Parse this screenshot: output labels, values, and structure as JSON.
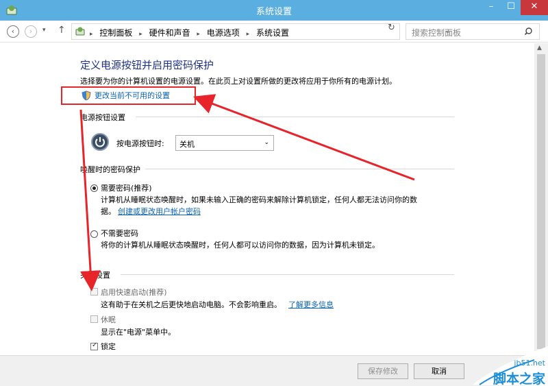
{
  "window": {
    "title": "系统设置",
    "minimize_label": "–",
    "maximize_label": "☐",
    "close_label": "✕"
  },
  "nav": {
    "back": "‹",
    "forward": "›",
    "history": "▾",
    "up": "↑",
    "breadcrumbs": [
      "控制面板",
      "硬件和声音",
      "电源选项",
      "系统设置"
    ],
    "separator": "▸",
    "address_dropdown": "⌄",
    "refresh": "↻",
    "search_placeholder": "搜索控制面板"
  },
  "page": {
    "title": "定义电源按钮并启用密码保护",
    "description": "选择要为你的计算机设置的电源设置。在此页上对设置所做的更改将应用于你所有的电源计划。",
    "change_link": "更改当前不可用的设置"
  },
  "power_button": {
    "section_title": "电源按钮设置",
    "label": "按电源按钮时:",
    "selected_value": "关机",
    "chevron": "⌄"
  },
  "wake_password": {
    "section_title": "唤醒时的密码保护",
    "require": {
      "label": "需要密码(推荐)",
      "selected": true,
      "desc_line1": "计算机从睡眠状态唤醒时，如果未输入正确的密码来解除计算机锁定，任何人都无法访问你的数",
      "desc_line2": "据。",
      "link": "创建或更改用户帐户密码"
    },
    "not_require": {
      "label": "不需要密码",
      "selected": false,
      "desc": "将你的计算机从睡眠状态唤醒时，任何人都可以访问你的数据，因为计算机未锁定。"
    }
  },
  "shutdown": {
    "section_title": "关机设置",
    "fast_startup": {
      "label": "启用快速启动(推荐)",
      "checked": false,
      "desc": "这有助于在关机之后更快地启动电脑。不会影响重启。",
      "link": "了解更多信息"
    },
    "sleep": {
      "label": "休眠",
      "checked": false,
      "desc": "显示在\"电源\"菜单中。"
    },
    "lock": {
      "label": "锁定",
      "checked": true
    }
  },
  "footer": {
    "save_label": "保存修改",
    "cancel_label": "取消"
  },
  "watermark": {
    "site": "jb51.net",
    "name": "脚本之家"
  },
  "colors": {
    "titlebar": "#5baee0",
    "close_button": "#c7373b",
    "heading": "#1e3287",
    "link": "#0a62b3",
    "annotation_red": "#e8242b",
    "watermark_blue": "#1c8ed8"
  }
}
